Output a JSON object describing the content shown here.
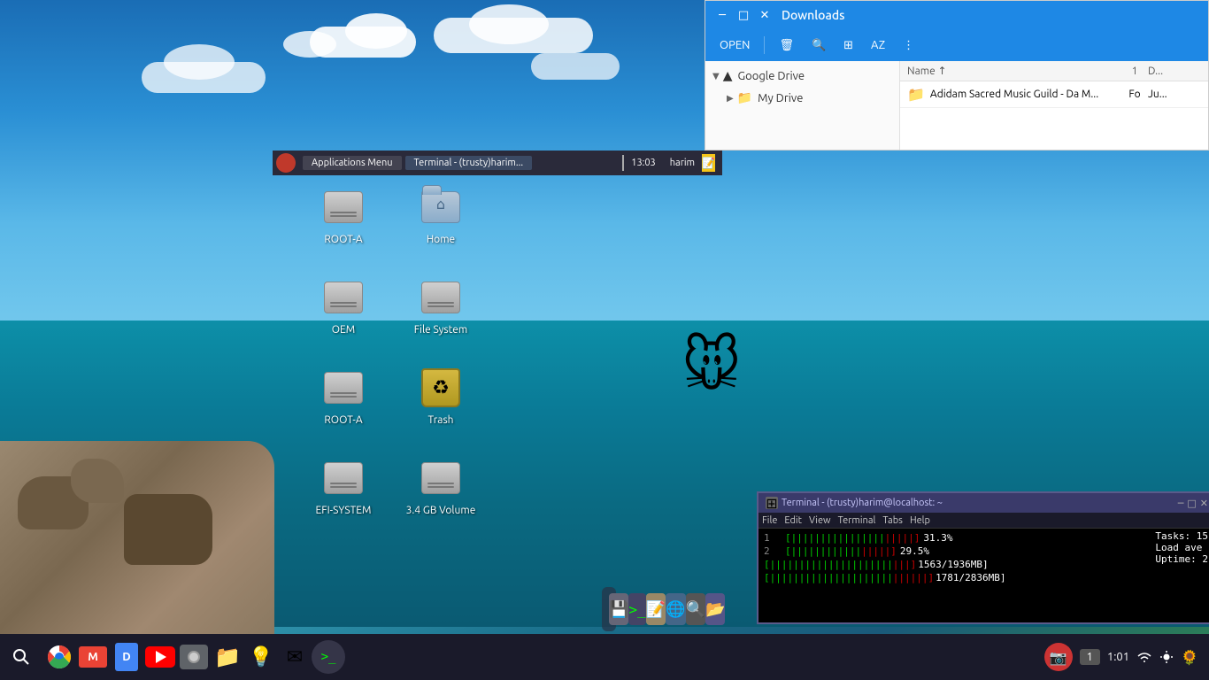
{
  "desktop": {
    "background": "ocean-beach"
  },
  "top_panel": {
    "logo": "xfce",
    "app_menu": "Applications Menu",
    "terminal_label": "Terminal - (trusty)harim...",
    "time": "13:03",
    "user": "harim"
  },
  "desktop_icons": [
    {
      "id": "root-a-1",
      "label": "ROOT-A",
      "type": "hdd"
    },
    {
      "id": "home",
      "label": "Home",
      "type": "home-folder"
    },
    {
      "id": "oem",
      "label": "OEM",
      "type": "hdd"
    },
    {
      "id": "file-system",
      "label": "File System",
      "type": "hdd"
    },
    {
      "id": "root-a-2",
      "label": "ROOT-A",
      "type": "hdd"
    },
    {
      "id": "trash",
      "label": "Trash",
      "type": "trash"
    },
    {
      "id": "efi-system",
      "label": "EFI-SYSTEM",
      "type": "hdd"
    },
    {
      "id": "volume-34gb",
      "label": "3.4 GB\nVolume",
      "type": "hdd"
    }
  ],
  "file_manager": {
    "title": "Downloads",
    "toolbar_buttons": [
      "OPEN",
      "delete",
      "search",
      "grid",
      "AZ",
      "more"
    ],
    "open_label": "OPEN",
    "sidebar": {
      "items": [
        {
          "label": "Google Drive",
          "expanded": true,
          "icon": "drive"
        },
        {
          "label": "My Drive",
          "expanded": false,
          "icon": "folder",
          "indent": true
        }
      ]
    },
    "content": {
      "columns": [
        "Name",
        "1",
        "D..."
      ],
      "rows": [
        {
          "icon": "folder",
          "name": "Adidam Sacred Music Guild - Da M...",
          "col1": "Fo",
          "col2": "Ju..."
        }
      ]
    },
    "window_controls": [
      "minimize",
      "maximize",
      "close"
    ]
  },
  "terminal": {
    "title": "Terminal - (trusty)harim@localhost: ~",
    "menu_items": [
      "File",
      "Edit",
      "View",
      "Terminal",
      "Tabs",
      "Help"
    ],
    "lines": [
      {
        "num": "1",
        "bar": "||||||||||||",
        "pct": "31.3%"
      },
      {
        "num": "2",
        "bar": "||||||||",
        "pct": "29.5%"
      },
      {
        "num": "",
        "mem_label": "1563/1936MB",
        "pct": ""
      },
      {
        "num": "",
        "mem_label": "1781/2836MB",
        "pct": ""
      }
    ],
    "tasks_label": "Tasks: 15",
    "load_label": "Load ave",
    "uptime_label": "Uptime: 2"
  },
  "taskbar": {
    "search_icon": "search",
    "apps": [
      {
        "name": "chromium",
        "color": "#4285f4",
        "symbol": "C"
      },
      {
        "name": "gmail",
        "color": "#ea4335",
        "symbol": "M"
      },
      {
        "name": "google-docs",
        "color": "#4285f4",
        "symbol": "D"
      },
      {
        "name": "youtube",
        "color": "#ff0000",
        "symbol": "▶"
      },
      {
        "name": "camera",
        "color": "#5f6368",
        "symbol": "◉"
      },
      {
        "name": "files",
        "color": "#1e88e5",
        "symbol": "📁"
      },
      {
        "name": "keep",
        "color": "#fbbc04",
        "symbol": "💡"
      },
      {
        "name": "gmail-2",
        "color": "#ea4335",
        "symbol": "✉"
      },
      {
        "name": "terminal",
        "color": "#333",
        "symbol": ">_"
      }
    ],
    "right": {
      "badge": "1",
      "time": "1:01",
      "wifi_icon": "wifi",
      "brightness_icon": "sun",
      "camera_icon": "camera"
    }
  },
  "taskbar_icons_bottom": [
    {
      "id": "file-manager-btn",
      "label": "💾"
    },
    {
      "id": "terminal-btn",
      "label": ">_"
    },
    {
      "id": "notes-btn",
      "label": "📝"
    },
    {
      "id": "browser-btn",
      "label": "🌐"
    },
    {
      "id": "search-btn",
      "label": "🔍"
    },
    {
      "id": "files-btn",
      "label": "📂"
    }
  ]
}
